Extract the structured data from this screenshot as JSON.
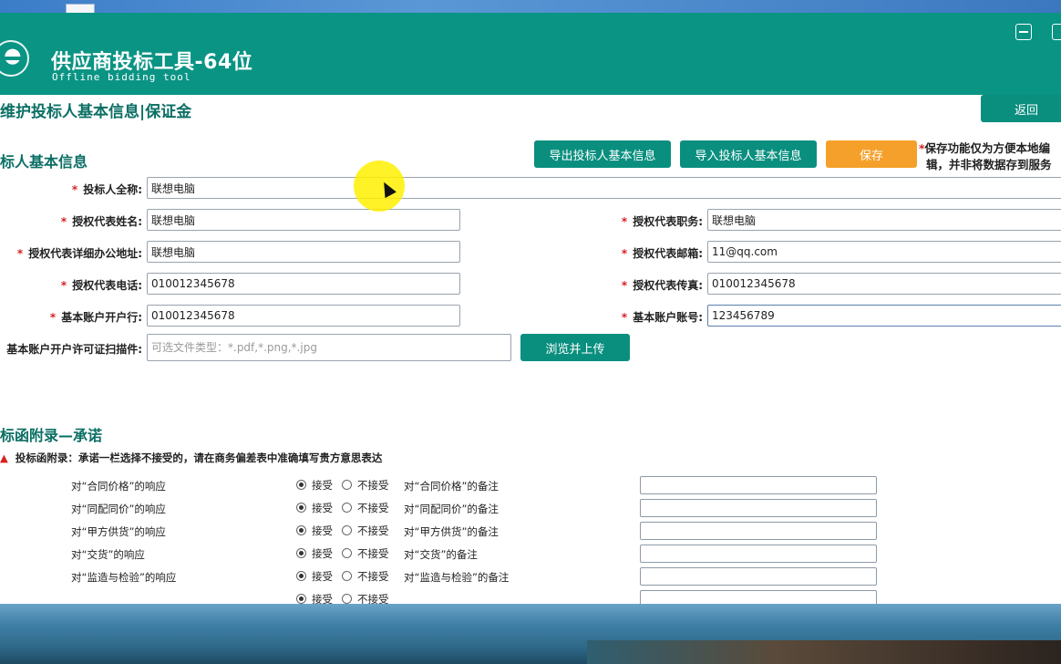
{
  "app": {
    "title": "供应商投标工具-64位",
    "subtitle": "Offline  bidding  tool"
  },
  "page": {
    "header": "维护投标人基本信息|保证金",
    "back_label": "返回"
  },
  "bidder_section": {
    "title": "标人基本信息",
    "export_label": "导出投标人基本信息",
    "import_label": "导入投标人基本信息",
    "save_label": "保存",
    "note_line1": "保存功能仅为方便本地编",
    "note_line2": "辑，并非将数据存到服务"
  },
  "fields": {
    "full_name": {
      "label": "投标人全称:",
      "value": "联想电脑"
    },
    "rep_name": {
      "label": "授权代表姓名:",
      "value": "联想电脑"
    },
    "rep_title": {
      "label": "授权代表职务:",
      "value": "联想电脑"
    },
    "rep_address": {
      "label": "授权代表详细办公地址:",
      "value": "联想电脑"
    },
    "rep_email": {
      "label": "授权代表邮箱:",
      "value": "11@qq.com"
    },
    "rep_phone": {
      "label": "授权代表电话:",
      "value": "010012345678"
    },
    "rep_fax": {
      "label": "授权代表传真:",
      "value": "010012345678"
    },
    "bank": {
      "label": "基本账户开户行:",
      "value": "010012345678"
    },
    "account": {
      "label": "基本账户账号:",
      "value": "123456789"
    },
    "license_scan": {
      "label": "基本账户开户许可证扫描件:",
      "placeholder": "可选文件类型：*.pdf,*.png,*.jpg"
    },
    "upload_label": "浏览并上传"
  },
  "commitment": {
    "title": "标函附录—承诺",
    "warning": "投标函附录：承诺一栏选择不接受的，请在商务偏差表中准确填写贵方意思表达",
    "accept": "接受",
    "reject": "不接受",
    "rows": [
      {
        "label": "对“合同价格”的响应",
        "remark": "对“合同价格”的备注"
      },
      {
        "label": "对“同配同价”的响应",
        "remark": "对“同配同价”的备注"
      },
      {
        "label": "对“甲方供货”的响应",
        "remark": "对“甲方供货”的备注"
      },
      {
        "label": "对“交货”的响应",
        "remark": "对“交货”的备注"
      },
      {
        "label": "对“监造与检验”的响应",
        "remark": "对“监造与检验”的备注"
      }
    ]
  },
  "colors": {
    "brand": "#0a9484",
    "button": "#0a8f7f",
    "save": "#f5a02a",
    "required": "#d62020"
  }
}
